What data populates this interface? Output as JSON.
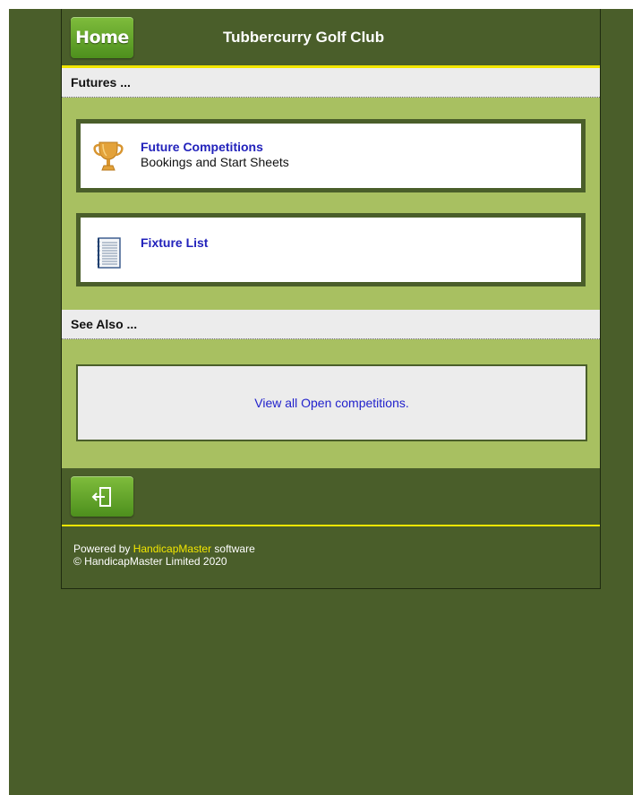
{
  "header": {
    "home_label": "Home",
    "site_title": "Tubbercurry Golf Club"
  },
  "sections": {
    "futures_title": "Futures ...",
    "see_also_title": "See Also ..."
  },
  "cards": [
    {
      "icon": "trophy-icon",
      "title": "Future Competitions",
      "subtitle": "Bookings and Start Sheets"
    },
    {
      "icon": "notebook-icon",
      "title": "Fixture List",
      "subtitle": ""
    }
  ],
  "see_also": {
    "link_text": "View all Open competitions."
  },
  "toolbar": {
    "exit_icon": "exit-icon"
  },
  "footer": {
    "powered_prefix": "Powered by ",
    "brand": "HandicapMaster",
    "powered_suffix": " software",
    "copyright": "© HandicapMaster Limited 2020"
  },
  "colors": {
    "page_background": "#4a5e2a",
    "panel_green": "#a8c061",
    "accent_yellow": "#f2e600",
    "link_blue": "#2222bb",
    "button_green": "#6aa52c"
  }
}
